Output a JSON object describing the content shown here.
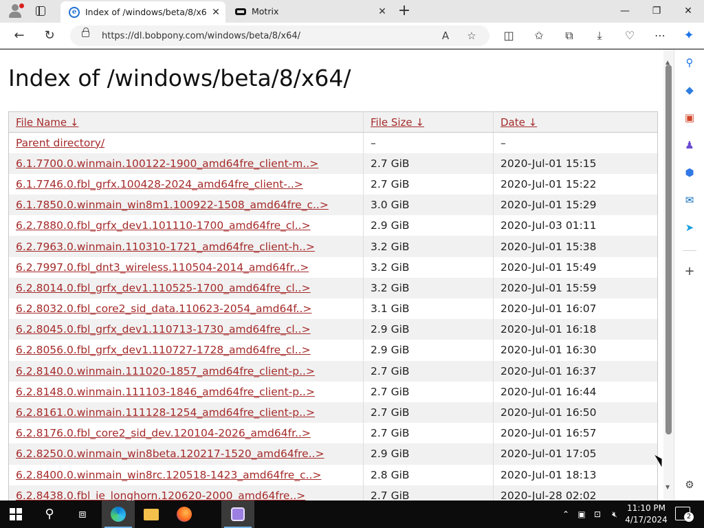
{
  "browser": {
    "tabs": [
      {
        "title": "Index of /windows/beta/8/x64/",
        "favicon": "ie-page-icon",
        "active": true
      },
      {
        "title": "Motrix",
        "favicon": "motrix-icon",
        "active": false
      }
    ],
    "url": "https://dl.bobpony.com/windows/beta/8/x64/",
    "window_controls": {
      "minimize": "—",
      "restore": "❐",
      "close": "✕"
    }
  },
  "page": {
    "title": "Index of /windows/beta/8/x64/",
    "columns": {
      "name": "File Name  ↓",
      "size": "File Size  ↓",
      "date": "Date  ↓"
    },
    "rows": [
      {
        "name": "Parent directory/",
        "size": "–",
        "date": "–"
      },
      {
        "name": "6.1.7700.0.winmain.100122-1900_amd64fre_client-m..>",
        "size": "2.7 GiB",
        "date": "2020-Jul-01 15:15"
      },
      {
        "name": "6.1.7746.0.fbl_grfx.100428-2024_amd64fre_client-..>",
        "size": "2.7 GiB",
        "date": "2020-Jul-01 15:22"
      },
      {
        "name": "6.1.7850.0.winmain_win8m1.100922-1508_amd64fre_c..>",
        "size": "3.0 GiB",
        "date": "2020-Jul-01 15:29"
      },
      {
        "name": "6.2.7880.0.fbl_grfx_dev1.101110-1700_amd64fre_cl..>",
        "size": "2.9 GiB",
        "date": "2020-Jul-03 01:11"
      },
      {
        "name": "6.2.7963.0.winmain.110310-1721_amd64fre_client-h..>",
        "size": "3.2 GiB",
        "date": "2020-Jul-01 15:38"
      },
      {
        "name": "6.2.7997.0.fbl_dnt3_wireless.110504-2014_amd64fr..>",
        "size": "3.2 GiB",
        "date": "2020-Jul-01 15:49"
      },
      {
        "name": "6.2.8014.0.fbl_grfx_dev1.110525-1700_amd64fre_cl..>",
        "size": "3.2 GiB",
        "date": "2020-Jul-01 15:59"
      },
      {
        "name": "6.2.8032.0.fbl_core2_sid_data.110623-2054_amd64f..>",
        "size": "3.1 GiB",
        "date": "2020-Jul-01 16:07"
      },
      {
        "name": "6.2.8045.0.fbl_grfx_dev1.110713-1730_amd64fre_cl..>",
        "size": "2.9 GiB",
        "date": "2020-Jul-01 16:18"
      },
      {
        "name": "6.2.8056.0.fbl_grfx_dev1.110727-1728_amd64fre_cl..>",
        "size": "2.9 GiB",
        "date": "2020-Jul-01 16:30"
      },
      {
        "name": "6.2.8140.0.winmain.111020-1857_amd64fre_client-p..>",
        "size": "2.7 GiB",
        "date": "2020-Jul-01 16:37"
      },
      {
        "name": "6.2.8148.0.winmain.111103-1846_amd64fre_client-p..>",
        "size": "2.7 GiB",
        "date": "2020-Jul-01 16:44"
      },
      {
        "name": "6.2.8161.0.winmain.111128-1254_amd64fre_client-p..>",
        "size": "2.7 GiB",
        "date": "2020-Jul-01 16:50"
      },
      {
        "name": "6.2.8176.0.fbl_core2_sid_dev.120104-2026_amd64fr..>",
        "size": "2.7 GiB",
        "date": "2020-Jul-01 16:57"
      },
      {
        "name": "6.2.8250.0.winmain_win8beta.120217-1520_amd64fre..>",
        "size": "2.9 GiB",
        "date": "2020-Jul-01 17:05"
      },
      {
        "name": "6.2.8400.0.winmain_win8rc.120518-1423_amd64fre_c..>",
        "size": "2.8 GiB",
        "date": "2020-Jul-01 18:13"
      },
      {
        "name": "6.2.8438.0.fbl_ie_longhorn.120620-2000_amd64fre..>",
        "size": "2.7 GiB",
        "date": "2020-Jul-28 02:02"
      }
    ]
  },
  "taskbar": {
    "time": "11:10 PM",
    "date": "4/17/2024",
    "notification_count": "2"
  },
  "colors": {
    "link": "#a52a2a",
    "row_alt": "#f1f1f1",
    "taskbar": "#0c0c0c"
  }
}
